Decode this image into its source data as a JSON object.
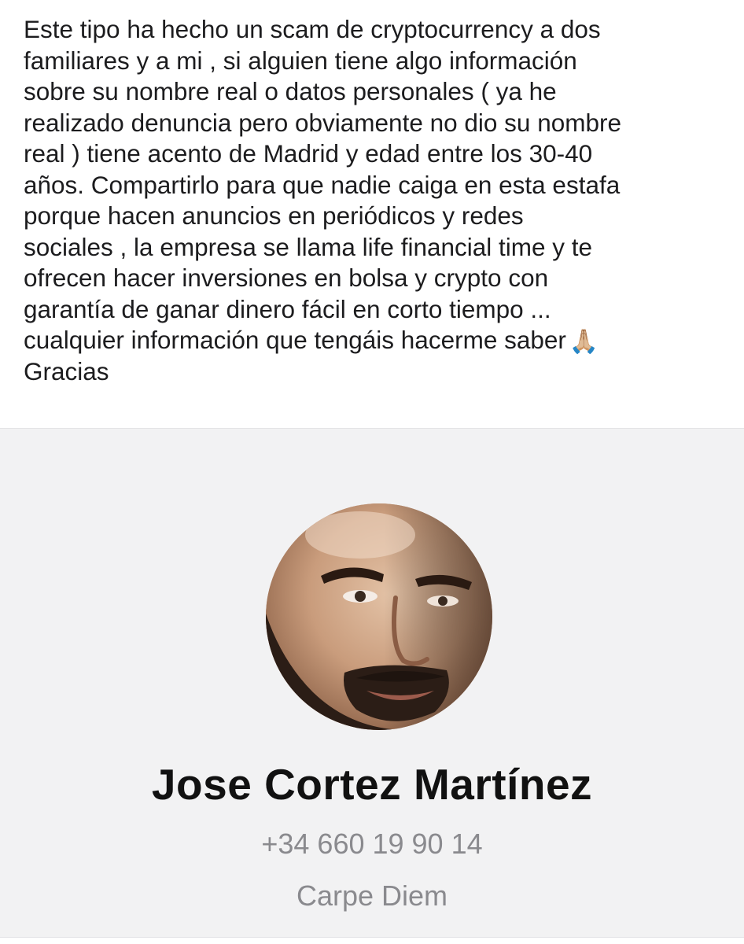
{
  "post": {
    "text": "Este tipo ha hecho un scam de cryptocurrency a dos\nfamiliares y a mi , si alguien tiene algo información\nsobre su nombre real o datos personales ( ya he\nrealizado denuncia pero obviamente no dio su nombre\nreal ) tiene acento de Madrid y edad entre los 30-40\naños. Compartirlo para que nadie caiga en esta estafa\nporque hacen anuncios en periódicos y redes\nsociales , la empresa se llama life financial time y te\nofrecen hacer inversiones en bolsa y crypto con\ngarantía de ganar dinero fácil en corto tiempo ...\ncualquier información que tengáis hacerme saber",
    "emoji": "🙏🏼",
    "closing": "Gracias",
    "emoji_icon": "praying-hands-icon"
  },
  "contact": {
    "name": "Jose Cortez Martínez",
    "phone": "+34 660 19 90 14",
    "status": "Carpe Diem",
    "avatar_icon": "profile-photo"
  },
  "colors": {
    "card_background": "#f2f2f3",
    "text_primary": "#1c1c1e",
    "text_secondary": "#8a8a8e"
  }
}
